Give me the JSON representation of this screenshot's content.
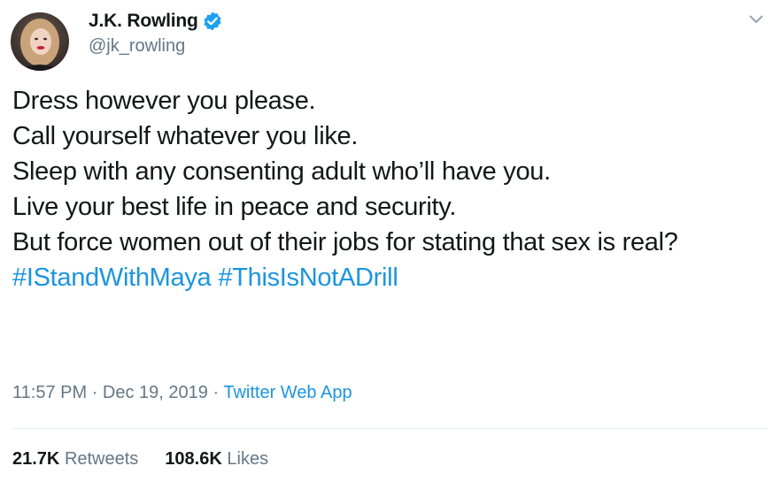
{
  "author": {
    "name": "J.K. Rowling",
    "handle": "@jk_rowling",
    "verified": true,
    "avatar_icon": "profile-photo"
  },
  "tweet": {
    "lines": [
      "Dress however you please.",
      "Call yourself whatever you like.",
      "Sleep with any consenting adult who’ll have you.",
      "Live your best life in peace and security.",
      "But force women out of their jobs for stating that sex is real?"
    ],
    "hashtags": [
      "#IStandWithMaya",
      "#ThisIsNotADrill"
    ]
  },
  "meta": {
    "time": "11:57 PM",
    "separator": "·",
    "date": "Dec 19, 2019",
    "source": "Twitter Web App"
  },
  "stats": {
    "retweets_count": "21.7K",
    "retweets_label": "Retweets",
    "likes_count": "108.6K",
    "likes_label": "Likes"
  },
  "colors": {
    "text": "#14171a",
    "secondary": "#657786",
    "link": "#1b95e0",
    "verified": "#1da1f2",
    "divider": "#e6ecf0"
  }
}
